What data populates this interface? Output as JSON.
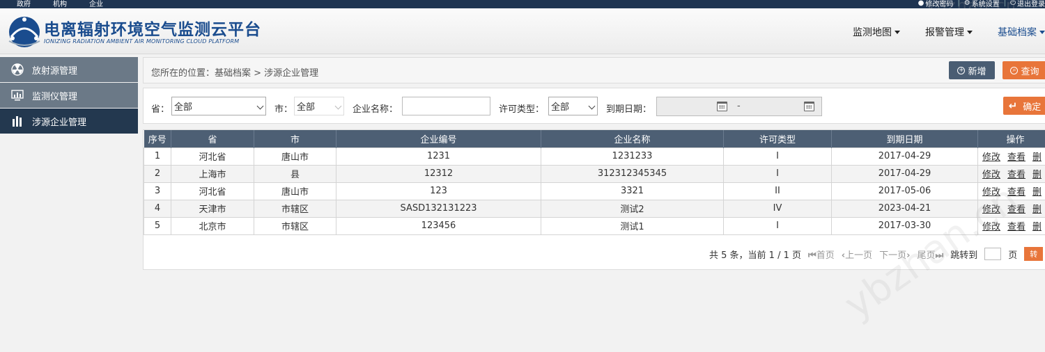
{
  "topbar": {
    "left_links": [
      "政府",
      "机构",
      "企业"
    ],
    "right_links": [
      "修改密码",
      "系统设置",
      "退出登录"
    ]
  },
  "header": {
    "title": "电离辐射环境空气监测云平台",
    "subtitle": "IONIZING RADIATION AMBIENT AIR MONITORING CLOUD PLATFORM",
    "nav": [
      "监测地图",
      "报警管理",
      "基础档案"
    ],
    "active_nav": "基础档案"
  },
  "sidebar": {
    "items": [
      {
        "label": "放射源管理",
        "icon": "radiation-icon"
      },
      {
        "label": "监测仪管理",
        "icon": "monitor-chart-icon"
      },
      {
        "label": "涉源企业管理",
        "icon": "building-icon"
      }
    ],
    "active": "涉源企业管理"
  },
  "breadcrumb": {
    "text": "您所在的位置：基础档案 > 涉源企业管理",
    "add_label": "新增",
    "query_label": "查询"
  },
  "filter": {
    "province_label": "省：",
    "province_value": "全部",
    "city_label": "市：",
    "city_value": "全部",
    "name_label": "企业名称：",
    "name_value": "",
    "license_label": "许可类型：",
    "license_value": "全部",
    "expiry_label": "到期日期：",
    "date_separator": "-",
    "confirm_label": "确定"
  },
  "table": {
    "headers": [
      "序号",
      "省",
      "市",
      "企业编号",
      "企业名称",
      "许可类型",
      "到期日期",
      "操作"
    ],
    "rows": [
      [
        "1",
        "河北省",
        "唐山市",
        "1231",
        "1231233",
        "I",
        "2017-04-29"
      ],
      [
        "2",
        "上海市",
        "县",
        "12312",
        "312312345345",
        "I",
        "2017-04-29"
      ],
      [
        "3",
        "河北省",
        "唐山市",
        "123",
        "3321",
        "II",
        "2017-05-06"
      ],
      [
        "4",
        "天津市",
        "市辖区",
        "SASD132131223",
        "测试2",
        "IV",
        "2023-04-21"
      ],
      [
        "5",
        "北京市",
        "市辖区",
        "123456",
        "测试1",
        "I",
        "2017-03-30"
      ]
    ],
    "ops": [
      "修改",
      "查看",
      "删"
    ]
  },
  "pager": {
    "summary": "共 5 条，当前 1 / 1 页",
    "first": "首页",
    "prev": "上一页",
    "next": "下一页",
    "last": "尾页",
    "jump_label": "跳转到",
    "page_unit": "页",
    "go_label": "转"
  },
  "colors": {
    "dark_navy": "#1f3552",
    "sidebar_active": "#23384f",
    "sidebar_item": "#6b7987",
    "table_header": "#4d5f74",
    "accent_orange": "#e8753a",
    "logo_blue": "#1a4c8e"
  }
}
